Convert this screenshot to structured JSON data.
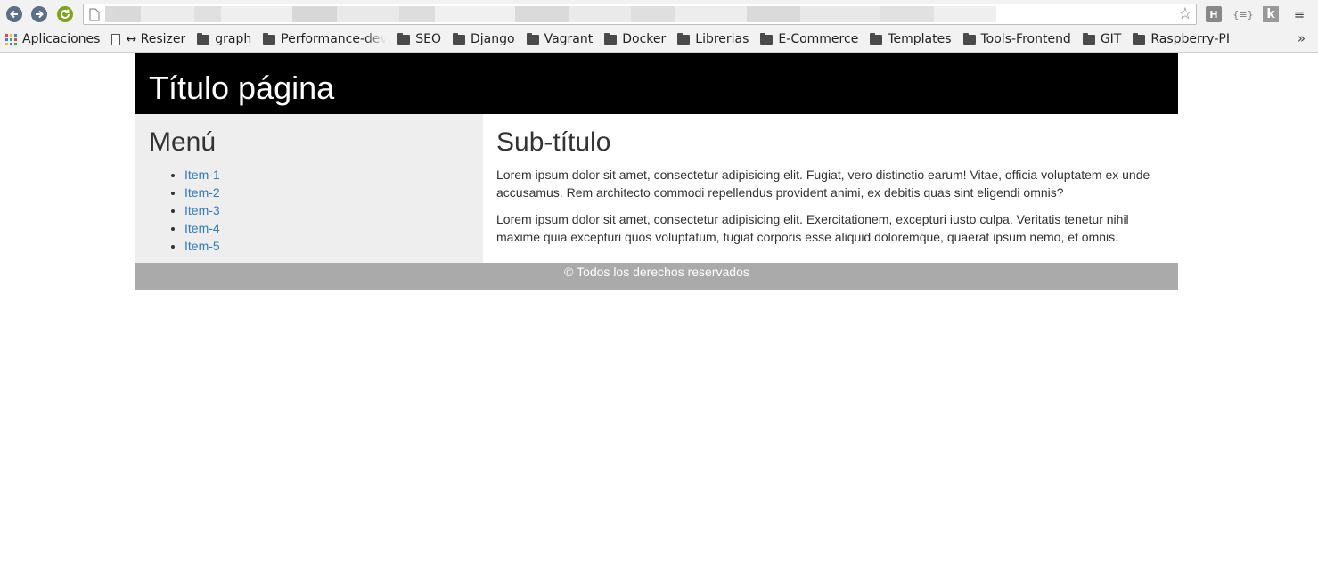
{
  "browser": {
    "bookmarks": [
      {
        "label": "Aplicaciones",
        "icon": "apps-grid-icon"
      },
      {
        "label": "↔ Resizer",
        "icon": "page-icon"
      },
      {
        "label": "graph",
        "icon": "folder-icon"
      },
      {
        "label": "Performance-dev",
        "icon": "folder-icon"
      },
      {
        "label": "SEO",
        "icon": "folder-icon"
      },
      {
        "label": "Django",
        "icon": "folder-icon"
      },
      {
        "label": "Vagrant",
        "icon": "folder-icon"
      },
      {
        "label": "Docker",
        "icon": "folder-icon"
      },
      {
        "label": "Librerias",
        "icon": "folder-icon"
      },
      {
        "label": "E-Commerce",
        "icon": "folder-icon"
      },
      {
        "label": "Templates",
        "icon": "folder-icon"
      },
      {
        "label": "Tools-Frontend",
        "icon": "folder-icon"
      },
      {
        "label": "GIT",
        "icon": "folder-icon"
      },
      {
        "label": "Raspberry-PI",
        "icon": "folder-icon"
      }
    ],
    "overflow_label": "»",
    "extensions": [
      "H",
      "{≡}",
      "k",
      "≡"
    ]
  },
  "page": {
    "title": "Título página",
    "menu_heading": "Menú",
    "menu_items": [
      "Item-1",
      "Item-2",
      "Item-3",
      "Item-4",
      "Item-5"
    ],
    "subtitle": "Sub-título",
    "paragraphs": [
      "Lorem ipsum dolor sit amet, consectetur adipisicing elit. Fugiat, vero distinctio earum! Vitae, officia voluptatem ex unde accusamus. Rem architecto commodi repellendus provident animi, ex debitis quas sint eligendi omnis?",
      "Lorem ipsum dolor sit amet, consectetur adipisicing elit. Exercitationem, excepturi iusto culpa. Veritatis tenetur nihil maxime quia excepturi quos voluptatum, fugiat corporis esse aliquid doloremque, quaerat ipsum nemo, et omnis."
    ],
    "footer": "© Todos los derechos reservados"
  },
  "colors": {
    "header_bg": "#000000",
    "sidebar_bg": "#eeeeee",
    "footer_bg": "#aaaaaa",
    "link": "#337ab7"
  }
}
